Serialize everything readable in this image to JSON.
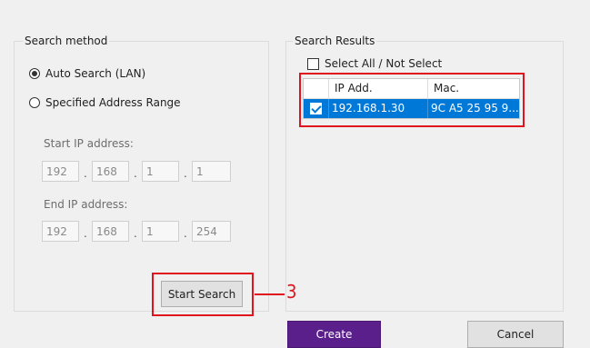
{
  "search_method": {
    "legend": "Search method",
    "radio_auto": "Auto Search (LAN)",
    "radio_range": "Specified Address Range",
    "start_label": "Start IP address:",
    "start_ip": [
      "192",
      "168",
      "1",
      "1"
    ],
    "end_label": "End IP address:",
    "end_ip": [
      "192",
      "168",
      "1",
      "254"
    ],
    "start_search_button": "Start Search",
    "selected": "Auto Search (LAN)"
  },
  "search_results": {
    "legend": "Search Results",
    "select_all_label": "Select All / Not Select",
    "columns": [
      "IP Add.",
      "Mac."
    ],
    "rows": [
      {
        "checked": true,
        "ip": "192.168.1.30",
        "mac": "9C A5 25 95 9..."
      }
    ]
  },
  "footer": {
    "create_button": "Create",
    "cancel_button": "Cancel"
  },
  "annotation": {
    "callout_number": "3",
    "highlight_color": "#e0141e"
  },
  "colors": {
    "accent": "#5b1f8c",
    "selection": "#0078d7"
  }
}
